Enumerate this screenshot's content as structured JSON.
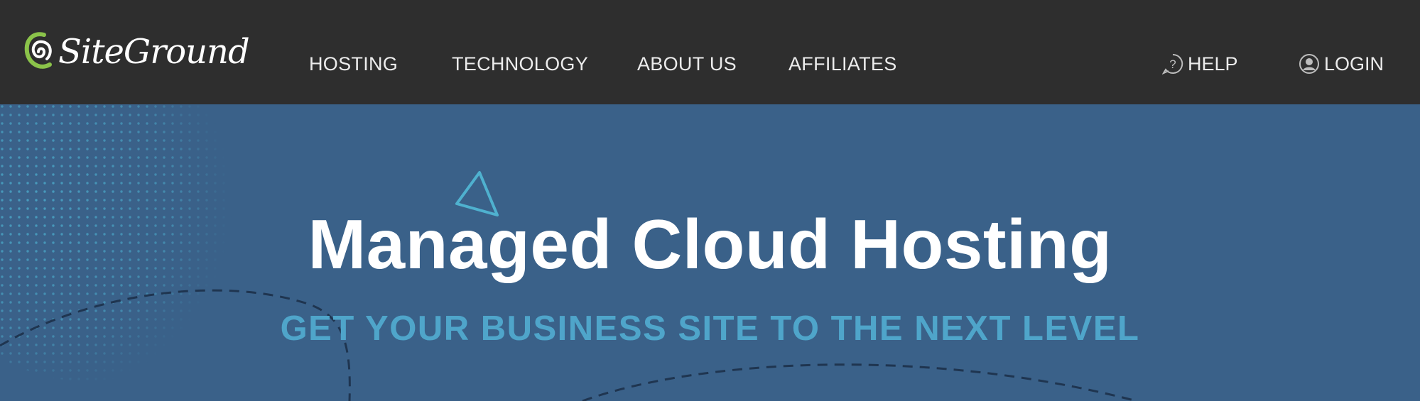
{
  "brand": {
    "name": "SiteGround"
  },
  "nav": {
    "items": [
      {
        "label": "HOSTING"
      },
      {
        "label": "TECHNOLOGY"
      },
      {
        "label": "ABOUT US"
      },
      {
        "label": "AFFILIATES"
      }
    ],
    "help_label": "HELP",
    "login_label": "LOGIN"
  },
  "hero": {
    "title": "Managed Cloud Hosting",
    "subtitle": "GET YOUR BUSINESS SITE TO THE NEXT LEVEL"
  },
  "colors": {
    "topbar": "#2e2e2e",
    "hero_bg": "#3a6189",
    "accent_blue": "#4fa5ca",
    "logo_green": "#8bc34a"
  },
  "icons": [
    "siteground-logo-icon",
    "help-icon",
    "user-icon",
    "triangle-icon"
  ]
}
